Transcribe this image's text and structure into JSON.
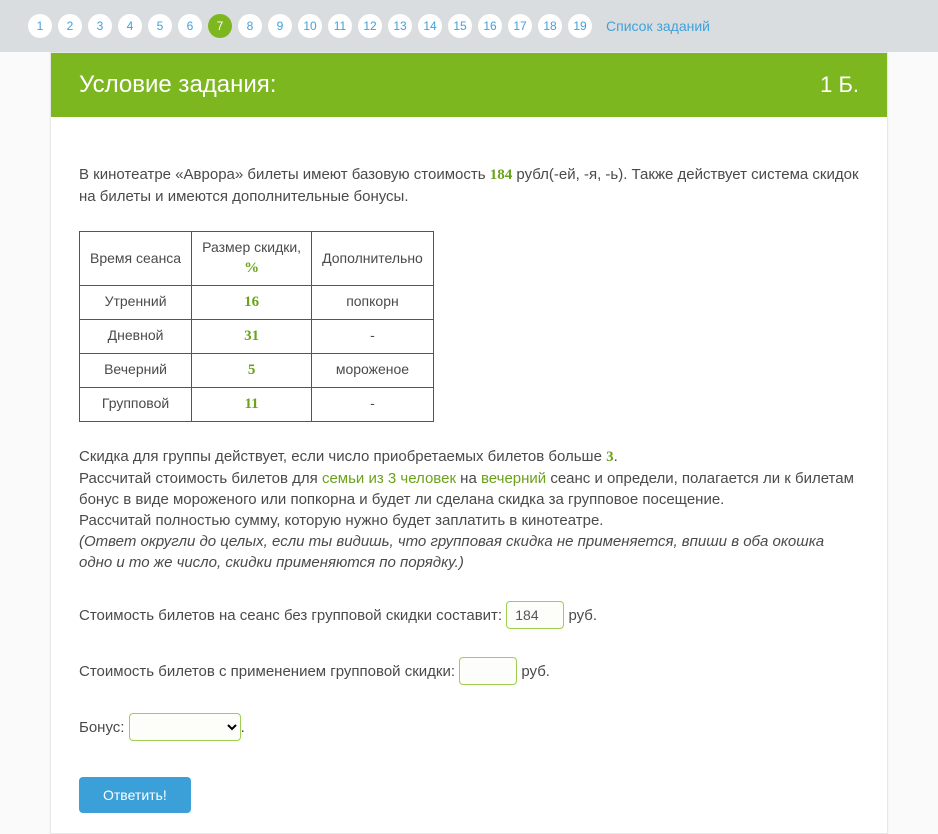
{
  "nav": {
    "items": [
      "1",
      "2",
      "3",
      "4",
      "5",
      "6",
      "7",
      "8",
      "9",
      "10",
      "11",
      "12",
      "13",
      "14",
      "15",
      "16",
      "17",
      "18",
      "19"
    ],
    "active_index": 6,
    "tasklist_label": "Список заданий"
  },
  "header": {
    "title": "Условие задания:",
    "points": "1 Б."
  },
  "intro": {
    "p1a": "В кинотеатре «Аврора» билеты имеют базовую стоимость ",
    "base_price": "184",
    "p1b": " рубл(-ей, -я, -ь). Также действует система скидок на билеты и имеются дополнительные бонусы."
  },
  "table": {
    "h1": "Время сеанса",
    "h2a": "Размер скидки,",
    "h2b": "%",
    "h3": "Дополнительно",
    "rows": [
      {
        "time": "Утренний",
        "disc": "16",
        "extra": "попкорн"
      },
      {
        "time": "Дневной",
        "disc": "31",
        "extra": "-"
      },
      {
        "time": "Вечерний",
        "disc": "5",
        "extra": "мороженое"
      },
      {
        "time": "Групповой",
        "disc": "11",
        "extra": "-"
      }
    ]
  },
  "task": {
    "l1a": "Скидка для группы действует, если число приобретаемых билетов больше ",
    "group_min": "3",
    "l1b": ".",
    "l2a": "Рассчитай стоимость билетов для ",
    "family": "семьи из 3 человек",
    "l2b": " на ",
    "session": "вечерний",
    "l2c": " сеанс и определи, полагается ли к билетам бонус в виде мороженого или попкорна и будет ли сделана скидка за групповое посещение.",
    "l3": "Рассчитай полностью сумму, которую нужно будет заплатить в кинотеатре.",
    "note": "(Ответ округли до целых, если ты видишь, что групповая скидка не применяется, впиши в оба окошка одно и то же число, скидки применяются по порядку.)"
  },
  "answers": {
    "line1_label": "Стоимость билетов на сеанс без групповой скидки составит: ",
    "line1_value": "184",
    "unit": " руб.",
    "line2_label": "Стоимость билетов с применением групповой скидки: ",
    "line2_value": "",
    "bonus_label": "Бонус: ",
    "bonus_value": "",
    "period": "."
  },
  "submit_label": "Ответить!"
}
